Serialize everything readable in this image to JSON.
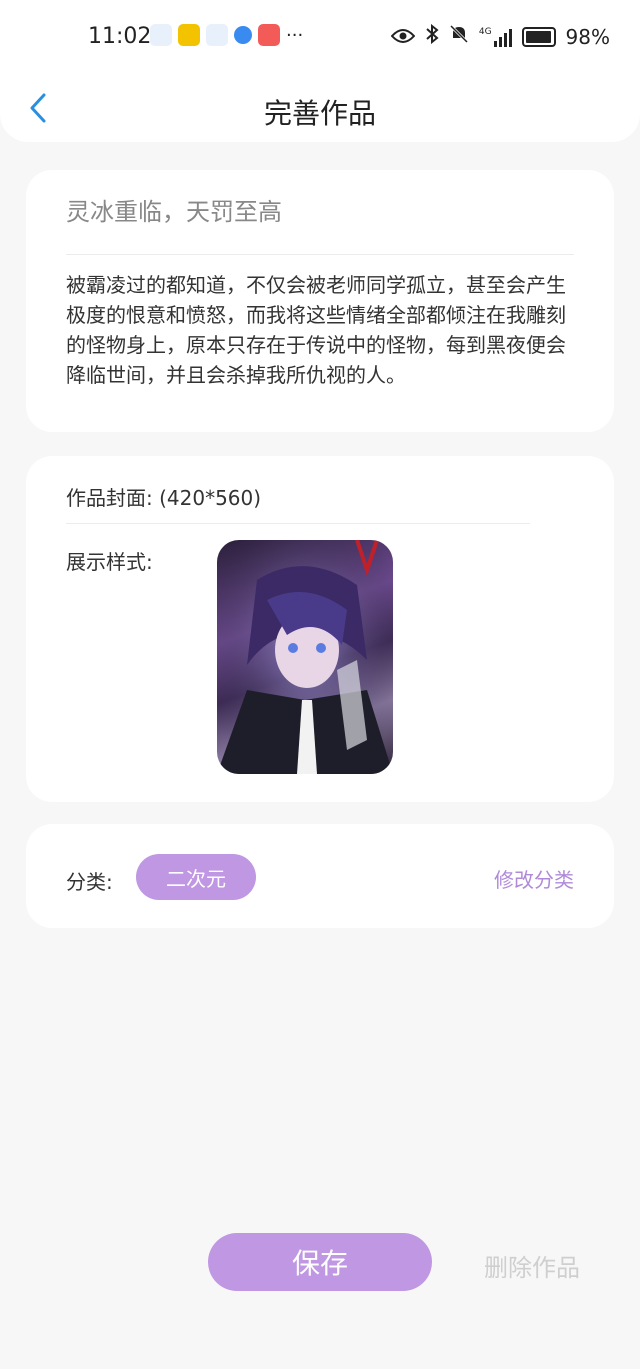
{
  "status_bar": {
    "time": "11:02",
    "battery": "98%",
    "network": "4G"
  },
  "header": {
    "title": "完善作品",
    "back_icon": "chevron-left-icon"
  },
  "work": {
    "title": "灵冰重临，天罚至高",
    "description": "被霸凌过的都知道，不仅会被老师同学孤立，甚至会产生极度的恨意和愤怒，而我将这些情绪全部都倾注在我雕刻的怪物身上，原本只存在于传说中的怪物，每到黑夜便会降临世间，并且会杀掉我所仇视的人。"
  },
  "cover": {
    "label": "作品封面: (420*560)",
    "style_label": "展示样式:"
  },
  "category": {
    "label": "分类:",
    "value": "二次元",
    "edit_label": "修改分类"
  },
  "actions": {
    "save_label": "保存",
    "delete_label": "删除作品"
  },
  "colors": {
    "accent": "#bf97e3",
    "back_icon": "#2a8fe0"
  }
}
